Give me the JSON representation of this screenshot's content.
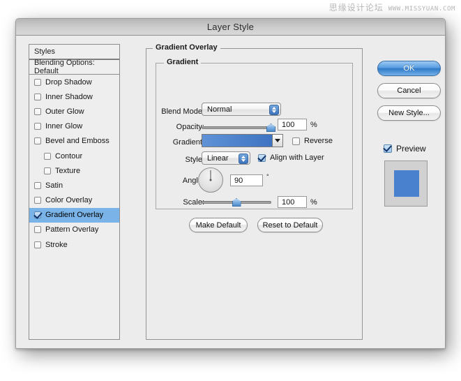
{
  "watermark": {
    "cn_text": "思缘设计论坛",
    "url_text": "WWW.MISSYUAN.COM"
  },
  "dialog": {
    "title": "Layer Style"
  },
  "styles_pane": {
    "header": "Styles",
    "blending_options": "Blending Options: Default",
    "items": [
      {
        "label": "Drop Shadow",
        "checked": false,
        "indent": false,
        "selected": false
      },
      {
        "label": "Inner Shadow",
        "checked": false,
        "indent": false,
        "selected": false
      },
      {
        "label": "Outer Glow",
        "checked": false,
        "indent": false,
        "selected": false
      },
      {
        "label": "Inner Glow",
        "checked": false,
        "indent": false,
        "selected": false
      },
      {
        "label": "Bevel and Emboss",
        "checked": false,
        "indent": false,
        "selected": false
      },
      {
        "label": "Contour",
        "checked": false,
        "indent": true,
        "selected": false
      },
      {
        "label": "Texture",
        "checked": false,
        "indent": true,
        "selected": false
      },
      {
        "label": "Satin",
        "checked": false,
        "indent": false,
        "selected": false
      },
      {
        "label": "Color Overlay",
        "checked": false,
        "indent": false,
        "selected": false
      },
      {
        "label": "Gradient Overlay",
        "checked": true,
        "indent": false,
        "selected": true
      },
      {
        "label": "Pattern Overlay",
        "checked": false,
        "indent": false,
        "selected": false
      },
      {
        "label": "Stroke",
        "checked": false,
        "indent": false,
        "selected": false
      }
    ]
  },
  "main": {
    "group_title": "Gradient Overlay",
    "subgroup_title": "Gradient",
    "blend_mode": {
      "label": "Blend Mode:",
      "value": "Normal"
    },
    "opacity": {
      "label": "Opacity:",
      "value": "100",
      "unit": "%",
      "slider_percent": 100
    },
    "gradient": {
      "label": "Gradient:",
      "swatch_start_color": "#5f92d6",
      "swatch_end_color": "#3e74c2",
      "reverse_label": "Reverse",
      "reverse_checked": false
    },
    "style": {
      "label": "Style:",
      "value": "Linear",
      "align_label": "Align with Layer",
      "align_checked": true
    },
    "angle": {
      "label": "Angle:",
      "value": "90",
      "unit": "°",
      "degrees": 90
    },
    "scale": {
      "label": "Scale:",
      "value": "100",
      "unit": "%",
      "slider_percent": 50
    },
    "make_default_label": "Make Default",
    "reset_default_label": "Reset to Default"
  },
  "right": {
    "ok_label": "OK",
    "cancel_label": "Cancel",
    "new_style_label": "New Style...",
    "preview_label": "Preview",
    "preview_checked": true,
    "preview_swatch_color": "#4a81cf"
  }
}
